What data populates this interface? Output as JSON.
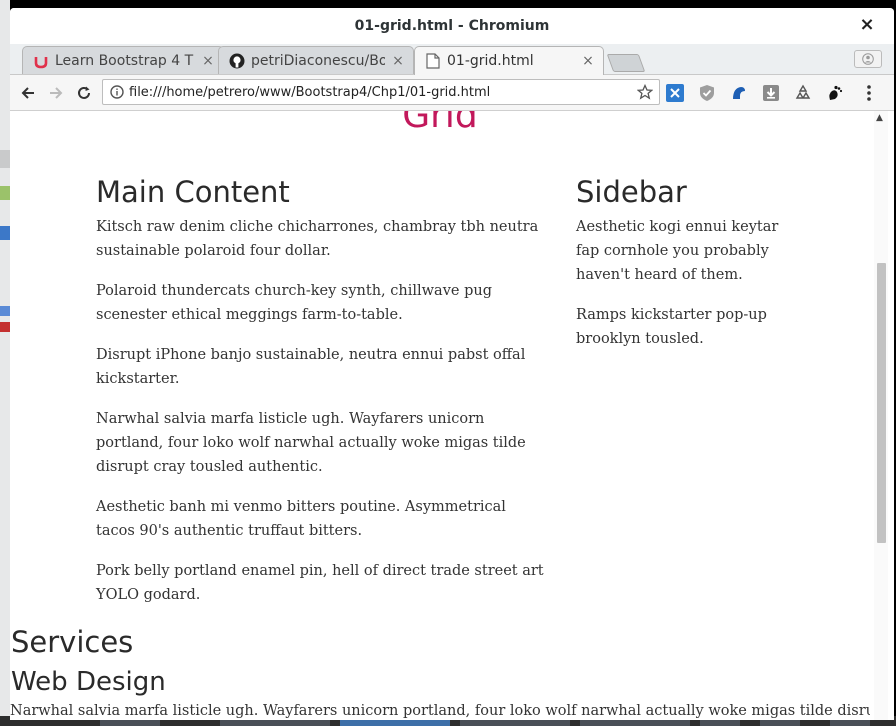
{
  "window": {
    "title": "01-grid.html - Chromium",
    "close_label": "×"
  },
  "tabs": [
    {
      "title": "Learn Bootstrap 4 T",
      "close": "×",
      "icon": "udemy-icon"
    },
    {
      "title": "petriDiaconescu/Bo",
      "close": "×",
      "icon": "github-icon"
    },
    {
      "title": "01-grid.html",
      "close": "×",
      "icon": "page-icon"
    }
  ],
  "omnibox": {
    "url": "file:///home/petrero/www/Bootstrap4/Chp1/01-grid.html"
  },
  "page": {
    "heading": "Grid",
    "main": {
      "title": "Main Content",
      "paragraphs": [
        "Kitsch raw denim cliche chicharrones, chambray tbh neutra sustainable polaroid four dollar.",
        "Polaroid thundercats church-key synth, chillwave pug scenester ethical meggings farm-to-table.",
        "Disrupt iPhone banjo sustainable, neutra ennui pabst offal kickstarter.",
        "Narwhal salvia marfa listicle ugh. Wayfarers unicorn portland, four loko wolf narwhal actually woke migas tilde disrupt cray tousled authentic.",
        "Aesthetic banh mi venmo bitters poutine. Asymmetrical tacos 90's authentic truffaut bitters.",
        "Pork belly portland enamel pin, hell of direct trade street art YOLO godard."
      ]
    },
    "sidebar": {
      "title": "Sidebar",
      "paragraphs": [
        "Aesthetic kogi ennui keytar fap cornhole you probably haven't heard of them.",
        "Ramps kickstarter pop-up brooklyn tousled."
      ]
    },
    "services_title": "Services",
    "web_design_title": "Web Design",
    "web_design_text": "Narwhal salvia marfa listicle ugh. Wayfarers unicorn portland, four loko wolf narwhal actually woke migas tilde disrupt"
  },
  "colors": {
    "heading_accent": "#c2185b",
    "text": "#333333"
  }
}
